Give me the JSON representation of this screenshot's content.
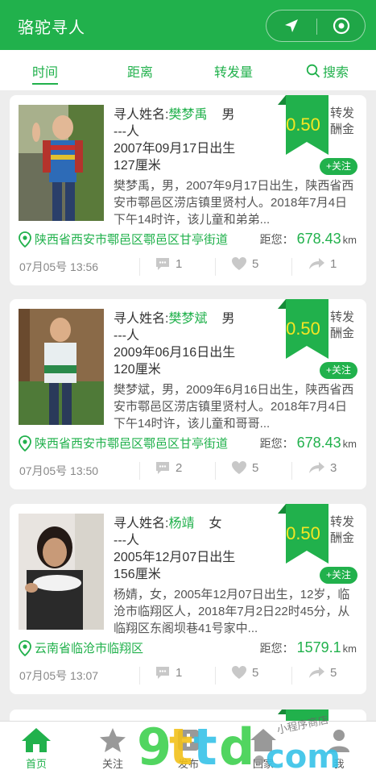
{
  "app": {
    "title": "骆驼寻人"
  },
  "tabs": [
    {
      "label": "时间",
      "active": true
    },
    {
      "label": "距离",
      "active": false
    },
    {
      "label": "转发量",
      "active": false
    },
    {
      "label": "搜索",
      "active": false,
      "icon": "search-icon"
    }
  ],
  "labels": {
    "name_prefix": "寻人姓名:",
    "reward": "转发酬金",
    "follow": "+关注",
    "distance_prefix": "距您：",
    "distance_unit": "km"
  },
  "cards": [
    {
      "name": "樊梦禹",
      "gender": "男",
      "type": "---人",
      "birth": "2007年09月17日出生",
      "height": "127厘米",
      "reward": "0.50",
      "desc": "樊梦禹，男，2007年9月17日出生，陕西省西安市鄠邑区涝店镇里贤村人。2018年7月4日下午14时许，该儿童和弟弟...",
      "location": "陕西省西安市鄠邑区鄠邑区甘亭街道",
      "distance": "678.43",
      "date": "07月05号 13:56",
      "comments": "1",
      "likes": "5",
      "shares": "1"
    },
    {
      "name": "樊梦斌",
      "gender": "男",
      "type": "---人",
      "birth": "2009年06月16日出生",
      "height": "120厘米",
      "reward": "0.50",
      "desc": "樊梦斌，男，2009年6月16日出生，陕西省西安市鄠邑区涝店镇里贤村人。2018年7月4日下午14时许，该儿童和哥哥...",
      "location": "陕西省西安市鄠邑区鄠邑区甘亭街道",
      "distance": "678.43",
      "date": "07月05号 13:50",
      "comments": "2",
      "likes": "5",
      "shares": "3"
    },
    {
      "name": "杨靖",
      "gender": "女",
      "type": "---人",
      "birth": "2005年12月07日出生",
      "height": "156厘米",
      "reward": "0.50",
      "desc": "杨婧，女，2005年12月07日出生，12岁，临沧市临翔区人，2018年7月2日22时45分，从临翔区东阁坝巷41号家中...",
      "location": "云南省临沧市临翔区",
      "distance": "1579.1",
      "date": "07月05号 13:07",
      "comments": "1",
      "likes": "5",
      "shares": "5"
    }
  ],
  "nav": [
    {
      "label": "首页",
      "active": true,
      "icon": "home-icon"
    },
    {
      "label": "关注",
      "active": false,
      "icon": "star-icon"
    },
    {
      "label": "发布",
      "active": false,
      "icon": "publish-icon"
    },
    {
      "label": "回家",
      "active": false,
      "icon": "house-icon"
    },
    {
      "label": "我",
      "active": false,
      "icon": "user-icon"
    }
  ],
  "watermark": {
    "text": "9ttd.com",
    "small": "小程序商店"
  },
  "colors": {
    "brand": "#21b14c",
    "reward": "#f5e623",
    "background": "#ededed"
  }
}
